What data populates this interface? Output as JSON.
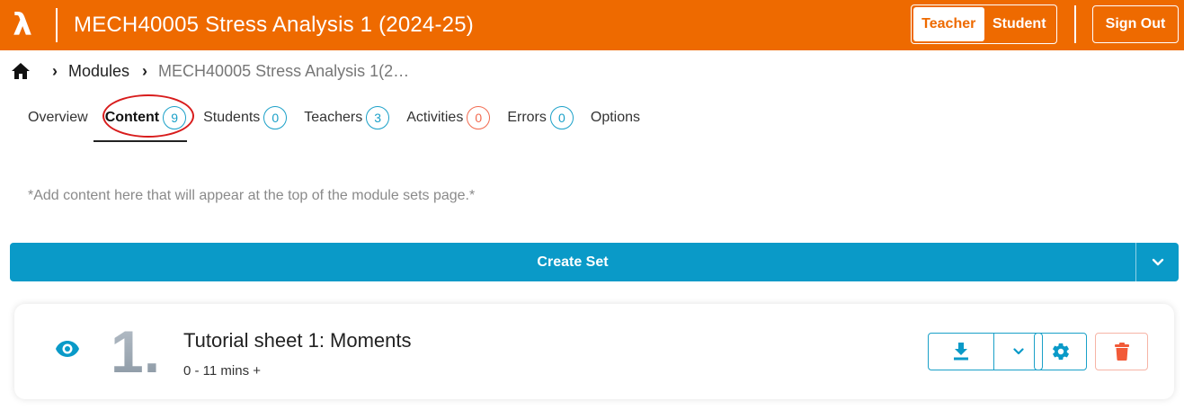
{
  "header": {
    "logo_glyph": "λ",
    "title": "MECH40005 Stress Analysis 1  (2024-25)",
    "roles": [
      {
        "label": "Teacher",
        "active": true
      },
      {
        "label": "Student",
        "active": false
      }
    ],
    "sign_out_label": "Sign Out",
    "color": "#ee6a00"
  },
  "breadcrumb": {
    "home_icon": "home-icon",
    "items": [
      {
        "label": "Modules"
      },
      {
        "label": "MECH40005 Stress Analysis 1(2…"
      }
    ]
  },
  "tabs": [
    {
      "label": "Overview",
      "count": null
    },
    {
      "label": "Content",
      "count": "9",
      "active": true
    },
    {
      "label": "Students",
      "count": "0"
    },
    {
      "label": "Teachers",
      "count": "3"
    },
    {
      "label": "Activities",
      "count": "0",
      "warn": true
    },
    {
      "label": "Errors",
      "count": "0"
    },
    {
      "label": "Options",
      "count": null
    }
  ],
  "intro_text": "*Add content here that will appear at the top of the module sets page.*",
  "create_set": {
    "label": "Create Set",
    "color": "#0a9ac8"
  },
  "sets": [
    {
      "number": "1.",
      "title": "Tutorial sheet 1: Moments",
      "duration": "0 - 11 mins +",
      "visible_icon": "eye-icon"
    }
  ]
}
